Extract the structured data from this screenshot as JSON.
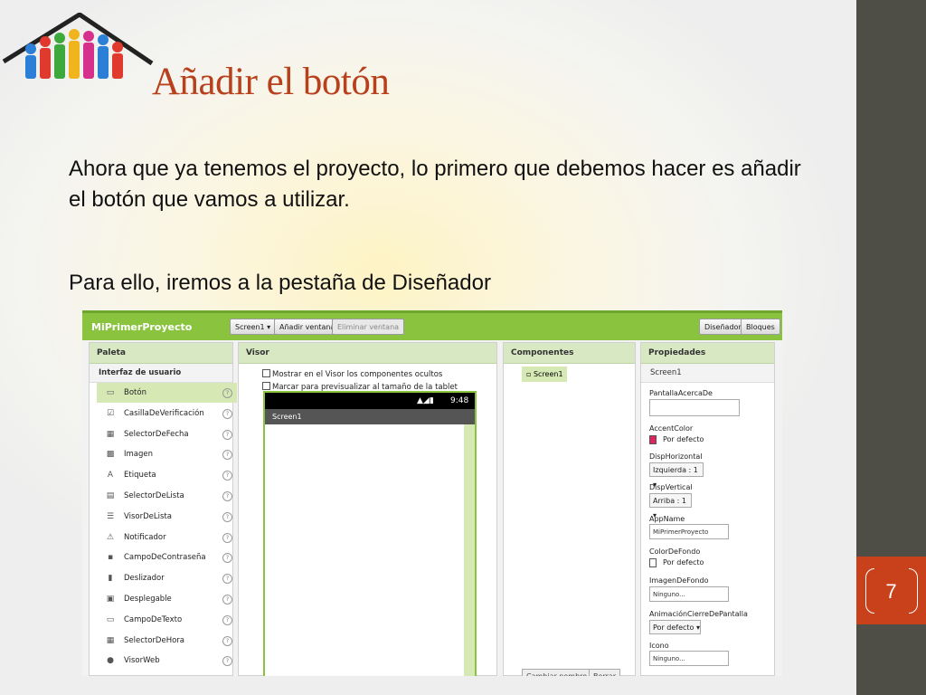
{
  "slide": {
    "title": "Añadir el botón",
    "paragraph1": "Ahora que ya tenemos el proyecto, lo primero que debemos hacer es añadir el botón que vamos a utilizar.",
    "paragraph2": "Para ello, iremos a la pestaña de Diseñador",
    "page_number": "7",
    "accent_color": "#b8401c",
    "logo_icon": "people-under-roof-logo"
  },
  "app": {
    "project_name": "MiPrimerProyecto",
    "screen_select": "Screen1",
    "add_screen": "Añadir ventana",
    "remove_screen": "Eliminar ventana",
    "designer": "Diseñador",
    "blocks": "Bloques",
    "brand_color": "#8ac43f"
  },
  "palette": {
    "title": "Paleta",
    "section": "Interfaz de usuario",
    "items": [
      {
        "label": "Botón",
        "icon": "button-icon",
        "glyph": "▭"
      },
      {
        "label": "CasillaDeVerificación",
        "icon": "checkbox-icon",
        "glyph": "☑"
      },
      {
        "label": "SelectorDeFecha",
        "icon": "calendar-icon",
        "glyph": "▦"
      },
      {
        "label": "Imagen",
        "icon": "image-icon",
        "glyph": "▩"
      },
      {
        "label": "Etiqueta",
        "icon": "label-icon",
        "glyph": "A"
      },
      {
        "label": "SelectorDeLista",
        "icon": "list-picker-icon",
        "glyph": "▤"
      },
      {
        "label": "VisorDeLista",
        "icon": "list-view-icon",
        "glyph": "☰"
      },
      {
        "label": "Notificador",
        "icon": "warning-icon",
        "glyph": "⚠"
      },
      {
        "label": "CampoDeContraseña",
        "icon": "password-icon",
        "glyph": "▪"
      },
      {
        "label": "Deslizador",
        "icon": "slider-icon",
        "glyph": "▮"
      },
      {
        "label": "Desplegable",
        "icon": "spinner-icon",
        "glyph": "▣"
      },
      {
        "label": "CampoDeTexto",
        "icon": "textbox-icon",
        "glyph": "▭"
      },
      {
        "label": "SelectorDeHora",
        "icon": "clock-icon",
        "glyph": "▦"
      },
      {
        "label": "VisorWeb",
        "icon": "globe-icon",
        "glyph": "●"
      }
    ]
  },
  "viewer": {
    "title": "Visor",
    "show_hidden": "Mostrar en el Visor los componentes ocultos",
    "preview_tablet": "Marcar para previsualizar al tamaño de la tablet",
    "time": "9:48",
    "screen_title": "Screen1"
  },
  "components": {
    "title": "Componentes",
    "item": "Screen1",
    "rename": "Cambiar nombre",
    "delete": "Borrar"
  },
  "properties": {
    "title": "Propiedades",
    "screen": "Screen1",
    "about": "PantallaAcercaDe",
    "accent_label": "AccentColor",
    "accent_value": "Por defecto",
    "accent_color": "#e0245e",
    "halign_label": "DispHorizontal",
    "halign_value": "Izquierda : 1",
    "valign_label": "DispVertical",
    "valign_value": "Arriba : 1",
    "appname_label": "AppName",
    "appname_value": "MiPrimerProyecto",
    "bg_label": "ColorDeFondo",
    "bg_value": "Por defecto",
    "bgimg_label": "ImagenDeFondo",
    "bgimg_value": "Ninguno...",
    "close_anim_label": "AnimaciónCierreDePantalla",
    "close_anim_value": "Por defecto",
    "icon_label": "Icono",
    "icon_value": "Ninguno..."
  }
}
